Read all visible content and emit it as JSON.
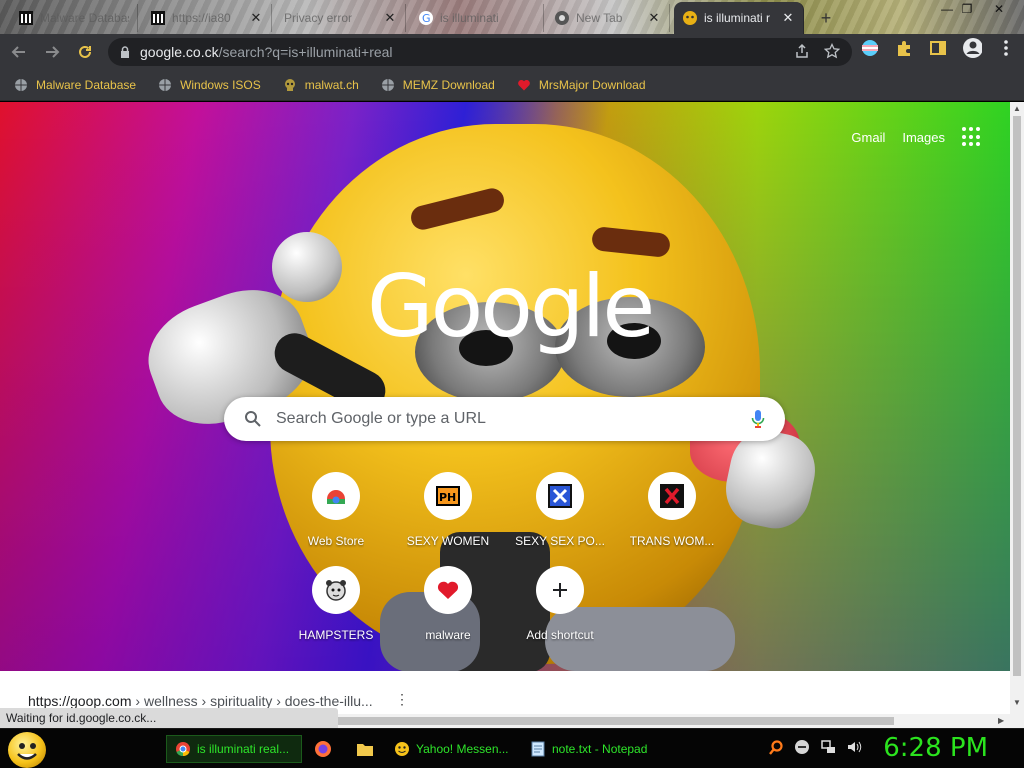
{
  "tabs": [
    {
      "title": "Malware Database",
      "favicon": "archive-icon"
    },
    {
      "title": "https://ia80",
      "favicon": "archive-icon"
    },
    {
      "title": "Privacy error",
      "favicon": "warning-icon"
    },
    {
      "title": "is illuminati",
      "favicon": "google-icon"
    },
    {
      "title": "New Tab",
      "favicon": "chrome-icon"
    },
    {
      "title": "is illuminati r",
      "favicon": "emoji-icon"
    }
  ],
  "toolbar": {
    "url_host": "google.co.ck",
    "url_path": "/search?q=is+illuminati+real"
  },
  "bookmarks": [
    {
      "label": "Malware Database",
      "icon": "globe-icon"
    },
    {
      "label": "Windows ISOS",
      "icon": "globe-icon"
    },
    {
      "label": "malwat.ch",
      "icon": "skull-icon"
    },
    {
      "label": "MEMZ Download",
      "icon": "globe-icon"
    },
    {
      "label": "MrsMajor Download",
      "icon": "heart-icon"
    }
  ],
  "ntp": {
    "gmail": "Gmail",
    "images": "Images",
    "logo": "Google",
    "search_placeholder": "Search Google or type a URL",
    "shortcuts": [
      {
        "label": "Web Store",
        "icon": "webstore-icon"
      },
      {
        "label": "SEXY WOMEN",
        "icon": "ph-icon"
      },
      {
        "label": "SEXY SEX PO...",
        "icon": "x-blue-icon"
      },
      {
        "label": "TRANS WOM...",
        "icon": "x-red-icon"
      },
      {
        "label": "HAMPSTERS",
        "icon": "hamster-icon"
      },
      {
        "label": "malware",
        "icon": "heart-icon"
      },
      {
        "label": "Add shortcut",
        "icon": "plus-icon"
      }
    ]
  },
  "page": {
    "crumb_host": "https://goop.com",
    "crumb_path": " › wellness › spirituality › does-the-illu..."
  },
  "status_text": "Waiting for id.google.co.ck...",
  "taskbar": {
    "items": [
      {
        "label": "is illuminati real...",
        "icon": "chrome-icon"
      },
      {
        "label": "",
        "icon": "firefox-icon"
      },
      {
        "label": "",
        "icon": "folder-icon"
      },
      {
        "label": "Yahoo! Messen...",
        "icon": "emoji-icon"
      },
      {
        "label": "note.txt - Notepad",
        "icon": "notepad-icon"
      }
    ],
    "clock": "6:28 PM"
  },
  "colors": {
    "bookmark_text": "#e8c34a",
    "taskbar_text": "#2ee52a",
    "clock": "#2be31e"
  }
}
